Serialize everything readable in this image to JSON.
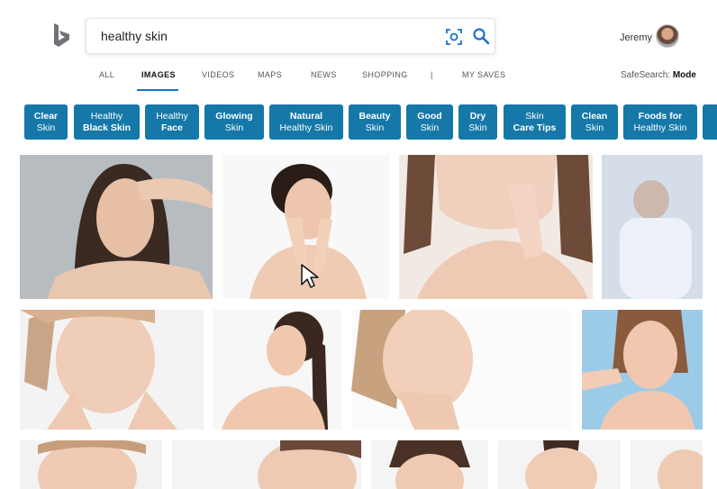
{
  "search": {
    "query": "healthy skin"
  },
  "user": {
    "name": "Jeremy"
  },
  "nav": {
    "items": [
      "ALL",
      "IMAGES",
      "VIDEOS",
      "MAPS",
      "NEWS",
      "SHOPPING",
      "|",
      "MY SAVES"
    ],
    "active": "IMAGES"
  },
  "safesearch": {
    "label": "SafeSearch:",
    "value": "Mode"
  },
  "chips": [
    {
      "line1": "Clear",
      "line2": "Skin"
    },
    {
      "line1": "Healthy",
      "line2": "Black Skin"
    },
    {
      "line1": "Healthy",
      "line2": "Face"
    },
    {
      "line1": "Glowing",
      "line2": "Skin"
    },
    {
      "line1": "Natural",
      "line2": "Healthy Skin"
    },
    {
      "line1": "Beauty",
      "line2": "Skin"
    },
    {
      "line1": "Good",
      "line2": "Skin"
    },
    {
      "line1": "Dry",
      "line2": "Skin"
    },
    {
      "line1": "Skin",
      "line2": "Care Tips"
    },
    {
      "line1": "Clean",
      "line2": "Skin"
    },
    {
      "line1": "Foods for",
      "line2": "Healthy Skin"
    }
  ],
  "colors": {
    "chip": "#1578a8",
    "accent": "#1a73c7",
    "bing_teal": "#0f8189"
  },
  "icons": [
    "bing-logo",
    "visual-search-icon",
    "search-icon",
    "cursor-arrow"
  ]
}
